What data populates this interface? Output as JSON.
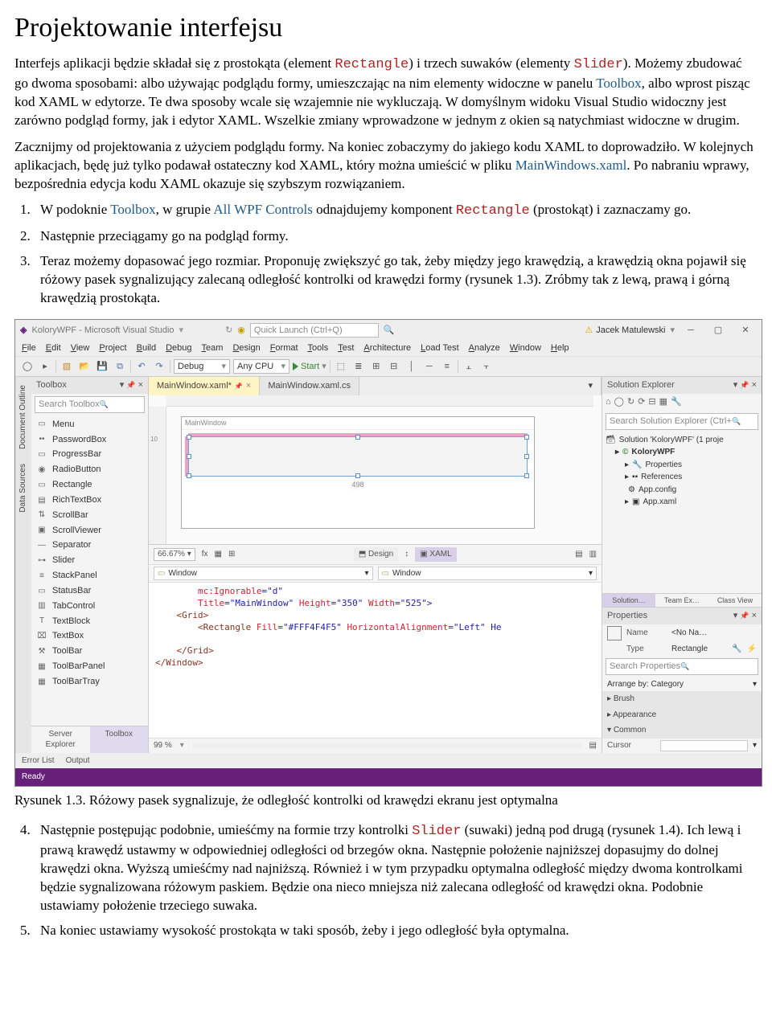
{
  "doc": {
    "heading": "Projektowanie interfejsu",
    "p1a": "Interfejs aplikacji będzie składał się z prostokąta (element ",
    "p1b": ") i trzech suwaków (elementy ",
    "p1c": "). Możemy zbudować go dwoma sposobami: albo używając podglądu formy, umieszczając na nim elementy widoczne w panelu ",
    "p1d": ", albo wprost pisząc kod XAML w edytorze. Te dwa sposoby wcale się wzajemnie nie wykluczają. W domyślnym widoku Visual Studio widoczny jest zarówno podgląd formy, jak i edytor XAML. Wszelkie zmiany wprowadzone w jednym z okien są natychmiast widoczne w drugim.",
    "p2a": "Zacznijmy od projektowania z użyciem podglądu formy. Na koniec zobaczymy do jakiego kodu XAML to doprowadziło. W kolejnych aplikacjach, będę już tylko podawał ostateczny kod XAML, który można umieścić w pliku ",
    "p2b": ". Po nabraniu wprawy, bezpośrednia edycja kodu XAML okazuje się szybszym rozwiązaniem.",
    "li1a": "W podoknie ",
    "li1b": ", w grupie ",
    "li1c": " odnajdujemy komponent ",
    "li1d": " (prostokąt) i zaznaczamy go.",
    "li2": "Następnie przeciągamy go na podgląd formy.",
    "li3": "Teraz możemy dopasować jego rozmiar. Proponuję zwiększyć go tak, żeby między jego krawędzią, a krawędzią okna pojawił się różowy pasek sygnalizujący zalecaną odległość kontrolki od krawędzi formy (rysunek 1.3). Zróbmy tak z lewą, prawą i górną krawędzią prostokąta.",
    "caption": "Rysunek 1.3. Różowy pasek sygnalizuje, że odległość kontrolki od krawędzi ekranu jest optymalna",
    "li4a": "Następnie postępując podobnie, umieśćmy na formie trzy kontrolki ",
    "li4b": " (suwaki) jedną pod drugą (rysunek 1.4). Ich lewą i prawą krawędź ustawmy w odpowiedniej odległości od brzegów okna. Następnie położenie najniższej dopasujmy do dolnej krawędzi okna. Wyższą umieśćmy nad najniższą. Również i w tym przypadku optymalna odległość między dwoma kontrolkami będzie sygnalizowana różowym paskiem. Będzie ona nieco mniejsza niż zalecana odległość od krawędzi okna. Podobnie ustawiamy położenie trzeciego suwaka.",
    "li5": "Na koniec ustawiamy wysokość prostokąta w taki sposób, żeby i jego odległość była optymalna.",
    "code_rect": "Rectangle",
    "code_slider": "Slider",
    "kw_toolbox": "Toolbox",
    "kw_allwpf": "All WPF Controls",
    "kw_mainwin": "MainWindows.xaml"
  },
  "vs": {
    "title": "KoloryWPF - Microsoft Visual Studio",
    "quick_placeholder": "Quick Launch (Ctrl+Q)",
    "user": "Jacek Matulewski",
    "menu": [
      "File",
      "Edit",
      "View",
      "Project",
      "Build",
      "Debug",
      "Team",
      "Design",
      "Format",
      "Tools",
      "Test",
      "Architecture",
      "Load Test",
      "Analyze",
      "Window",
      "Help"
    ],
    "toolbar": {
      "combo_debug": "Debug",
      "combo_cpu": "Any CPU",
      "start": "Start"
    },
    "sidetabs": [
      "Document Outline",
      "Data Sources"
    ],
    "toolbox": {
      "title": "Toolbox",
      "search": "Search Toolbox",
      "items": [
        {
          "icon": "▭",
          "label": "Menu"
        },
        {
          "icon": "••",
          "label": "PasswordBox"
        },
        {
          "icon": "▭",
          "label": "ProgressBar"
        },
        {
          "icon": "◉",
          "label": "RadioButton"
        },
        {
          "icon": "▭",
          "label": "Rectangle"
        },
        {
          "icon": "▤",
          "label": "RichTextBox"
        },
        {
          "icon": "⇅",
          "label": "ScrollBar"
        },
        {
          "icon": "▣",
          "label": "ScrollViewer"
        },
        {
          "icon": "—",
          "label": "Separator"
        },
        {
          "icon": "⊶",
          "label": "Slider"
        },
        {
          "icon": "≡",
          "label": "StackPanel"
        },
        {
          "icon": "▭",
          "label": "StatusBar"
        },
        {
          "icon": "▥",
          "label": "TabControl"
        },
        {
          "icon": "T",
          "label": "TextBlock"
        },
        {
          "icon": "⌧",
          "label": "TextBox"
        },
        {
          "icon": "⚒",
          "label": "ToolBar"
        },
        {
          "icon": "▦",
          "label": "ToolBarPanel"
        },
        {
          "icon": "▦",
          "label": "ToolBarTray"
        }
      ],
      "foot_left": "Server Explorer",
      "foot_right": "Toolbox"
    },
    "editor": {
      "tab_active": "MainWindow.xaml*",
      "tab_other": "MainWindow.xaml.cs",
      "ruler10": "10",
      "ruler_dim": "498",
      "form_caption": "MainWindow",
      "zoom": "66.67%",
      "tab_design": "Design",
      "tab_xaml": "XAML",
      "dd_window": "Window",
      "xaml_line1_a": "mc:Ignorable",
      "xaml_line1_b": "=\"d\"",
      "xaml_line2_a": "Title",
      "xaml_line2_b": "=\"MainWindow\" ",
      "xaml_line2_c": "Height",
      "xaml_line2_d": "=\"350\" ",
      "xaml_line2_e": "Width",
      "xaml_line2_f": "=\"525\">",
      "xaml_grid_open": "<Grid>",
      "xaml_rect_a": "<Rectangle ",
      "xaml_rect_b": "Fill",
      "xaml_rect_c": "=\"#FFF4F4F5\" ",
      "xaml_rect_d": "HorizontalAlignment",
      "xaml_rect_e": "=\"Left\" He",
      "xaml_grid_close": "</Grid>",
      "xaml_win_close": "</Window>",
      "foot_zoom": "99 %"
    },
    "right": {
      "se_title": "Solution Explorer",
      "se_search": "Search Solution Explorer (Ctrl+",
      "se_sol": "Solution 'KoloryWPF' (1 proje",
      "se_proj": "KoloryWPF",
      "se_props": "Properties",
      "se_refs": "References",
      "se_app": "App.config",
      "se_appx": "App.xaml",
      "se_tabs": [
        "Solution…",
        "Team Ex…",
        "Class View"
      ],
      "props_title": "Properties",
      "props_name_lab": "Name",
      "props_name_val": "<No Na…",
      "props_type_lab": "Type",
      "props_type_val": "Rectangle",
      "props_search": "Search Properties",
      "props_arrange": "Arrange by: Category",
      "props_grp_brush": "Brush",
      "props_grp_appear": "Appearance",
      "props_grp_common": "Common",
      "props_cursor": "Cursor"
    },
    "bottom_tabs": [
      "Error List",
      "Output"
    ],
    "status": "Ready"
  }
}
